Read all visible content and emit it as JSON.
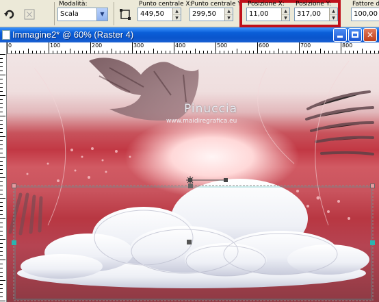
{
  "toolbar": {
    "mode_label": "Modalità:",
    "mode_value": "Scala",
    "center_x_label": "Punto centrale X:",
    "center_x_value": "449,50",
    "center_y_label": "Punto centrale Y:",
    "center_y_value": "299,50",
    "pos_x_label": "Posizione X:",
    "pos_x_value": "11,00",
    "pos_y_label": "Posizione Y:",
    "pos_y_value": "317,00",
    "factor_label": "Fattore d",
    "factor_value": "100,00",
    "highlight_color": "#c0101a"
  },
  "window": {
    "title": "Immagine2* @  60% (Raster 4)",
    "minimize_icon": "minimize-icon",
    "maximize_icon": "maximize-icon",
    "close_icon": "close-icon"
  },
  "ruler": {
    "labels": [
      "0",
      "100",
      "200",
      "300",
      "400",
      "500",
      "600",
      "700",
      "800"
    ]
  },
  "canvas": {
    "watermark_name": "Pinuccia",
    "watermark_site": "www.maidiregrafica.eu"
  },
  "colors": {
    "title_bar": "#0a55cc",
    "selection_handle": "#2ab5b0",
    "pick_handle": "#555555"
  }
}
